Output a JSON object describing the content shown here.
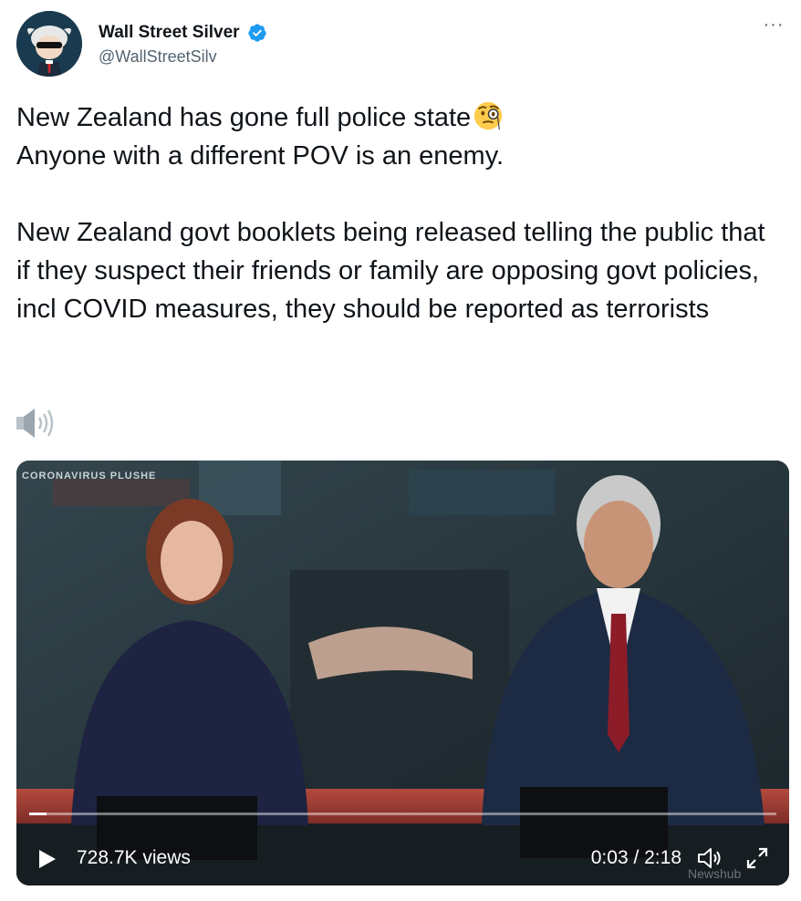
{
  "author": {
    "display_name": "Wall Street Silver",
    "handle": "@WallStreetSilv",
    "verified": true,
    "avatar_icon": "bull-with-sunglasses-avatar"
  },
  "menu": {
    "label": "···"
  },
  "tweet": {
    "line1": "New Zealand has gone full police state",
    "line1_emoji": "face-with-monocle",
    "line2": "Anyone with a different POV is an enemy.",
    "paragraph2": "New Zealand govt booklets being released telling the public that if they suspect their friends or family are opposing govt policies, incl COVID measures, they should be reported as terrorists"
  },
  "sound_indicator": {
    "icon": "speaker-icon"
  },
  "video": {
    "overlay_text": "CORONAVIRUS PLUSHE",
    "views": "728.7K views",
    "time": "0:03 / 2:18",
    "progress": 0.023,
    "icons": {
      "play": "play-icon",
      "volume": "volume-icon",
      "fullscreen": "fullscreen-icon"
    }
  },
  "colors": {
    "verified": "#1d9bf0",
    "secondary_text": "#536471",
    "primary_text": "#0f1419"
  }
}
